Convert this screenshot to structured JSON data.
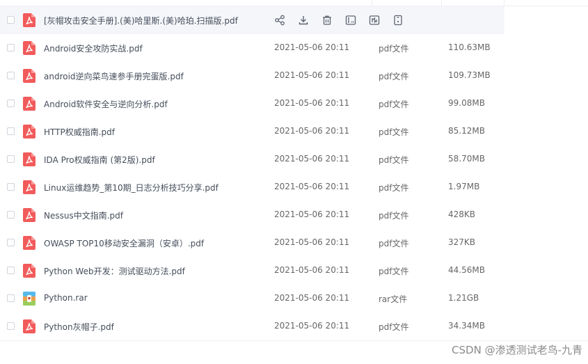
{
  "files": [
    {
      "name": "[灰帽攻击安全手册].(美)哈里斯.(美)哈珀.扫描版.pdf",
      "date": "",
      "type": "",
      "size": "",
      "kind": "pdf",
      "hovered": true
    },
    {
      "name": "Android安全攻防实战.pdf",
      "date": "2021-05-06 20:11",
      "type": "pdf文件",
      "size": "110.63MB",
      "kind": "pdf"
    },
    {
      "name": "android逆向菜鸟速参手册完蛋版.pdf",
      "date": "2021-05-06 20:11",
      "type": "pdf文件",
      "size": "109.73MB",
      "kind": "pdf"
    },
    {
      "name": "Android软件安全与逆向分析.pdf",
      "date": "2021-05-06 20:11",
      "type": "pdf文件",
      "size": "99.08MB",
      "kind": "pdf"
    },
    {
      "name": "HTTP权威指南.pdf",
      "date": "2021-05-06 20:11",
      "type": "pdf文件",
      "size": "85.12MB",
      "kind": "pdf"
    },
    {
      "name": "IDA Pro权威指南 (第2版).pdf",
      "date": "2021-05-06 20:11",
      "type": "pdf文件",
      "size": "58.70MB",
      "kind": "pdf"
    },
    {
      "name": "Linux运维趋势_第10期_日志分析技巧分享.pdf",
      "date": "2021-05-06 20:11",
      "type": "pdf文件",
      "size": "1.97MB",
      "kind": "pdf"
    },
    {
      "name": "Nessus中文指南.pdf",
      "date": "2021-05-06 20:11",
      "type": "pdf文件",
      "size": "428KB",
      "kind": "pdf"
    },
    {
      "name": "OWASP TOP10移动安全漏洞（安卓）.pdf",
      "date": "2021-05-06 20:11",
      "type": "pdf文件",
      "size": "327KB",
      "kind": "pdf"
    },
    {
      "name": "Python Web开发：测试驱动方法.pdf",
      "date": "2021-05-06 20:11",
      "type": "pdf文件",
      "size": "44.56MB",
      "kind": "pdf"
    },
    {
      "name": "Python.rar",
      "date": "2021-05-06 20:11",
      "type": "rar文件",
      "size": "1.21GB",
      "kind": "rar"
    },
    {
      "name": "Python灰帽子.pdf",
      "date": "2021-05-06 20:11",
      "type": "pdf文件",
      "size": "34.34MB",
      "kind": "pdf"
    }
  ],
  "row_actions": [
    {
      "name": "share-icon"
    },
    {
      "name": "download-icon"
    },
    {
      "name": "delete-icon"
    },
    {
      "name": "rename-icon"
    },
    {
      "name": "move-icon"
    },
    {
      "name": "more-icon"
    }
  ],
  "colors": {
    "pdf": "#f25b5b",
    "rar_top": "#57b9ea",
    "rar_mid": "#f0a04b",
    "rar_bot": "#9acd5a",
    "icon_gray": "#5c6470"
  },
  "watermark": "CSDN @渗透测试老鸟-九青"
}
